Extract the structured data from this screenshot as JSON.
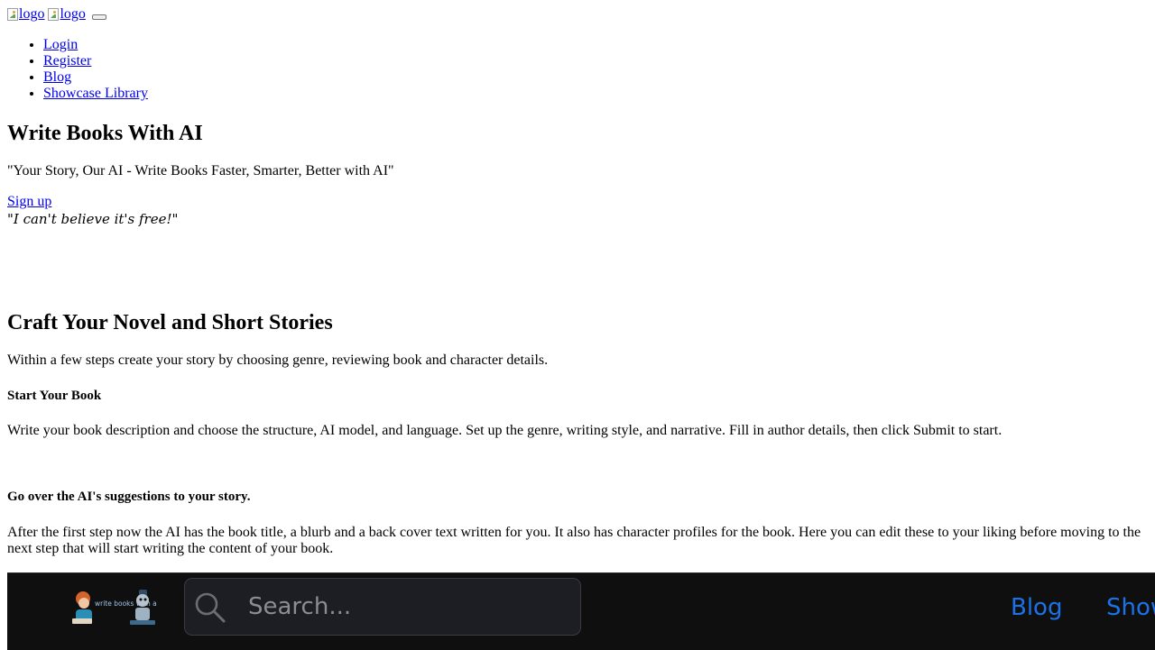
{
  "header": {
    "logo_alt_1": "logo",
    "logo_alt_2": "logo"
  },
  "nav": {
    "items": [
      {
        "label": "Login"
      },
      {
        "label": "Register"
      },
      {
        "label": "Blog"
      },
      {
        "label": "Showcase Library"
      }
    ]
  },
  "hero": {
    "title": "Write Books With AI",
    "tagline": "\"Your Story, Our AI - Write Books Faster, Smarter, Better with AI\"",
    "signup_label": "Sign up",
    "quote": "\"I can't believe it's free!\""
  },
  "features": {
    "title": "Craft Your Novel and Short Stories",
    "intro": "Within a few steps create your story by choosing genre, reviewing book and character details.",
    "steps": [
      {
        "title": "Start Your Book",
        "text": "Write your book description and choose the structure, AI model, and language. Set up the genre, writing style, and narrative. Fill in author details, then click Submit to start."
      },
      {
        "title": "Go over the AI's suggestions to your story.",
        "text": "After the first step now the AI has the book title, a blurb and a back cover text written for you. It also has character profiles for the book. Here you can edit these to your liking before moving to the next step that will start writing the content of your book."
      }
    ]
  },
  "navbar": {
    "logo_text": "write books with ai",
    "search_placeholder": "Search...",
    "links": [
      {
        "label": "Blog"
      },
      {
        "label": "Showcase Library"
      }
    ],
    "colors": {
      "background": "#0f0f10",
      "search_bg": "#1d1e23",
      "link": "#1a73e8"
    }
  }
}
